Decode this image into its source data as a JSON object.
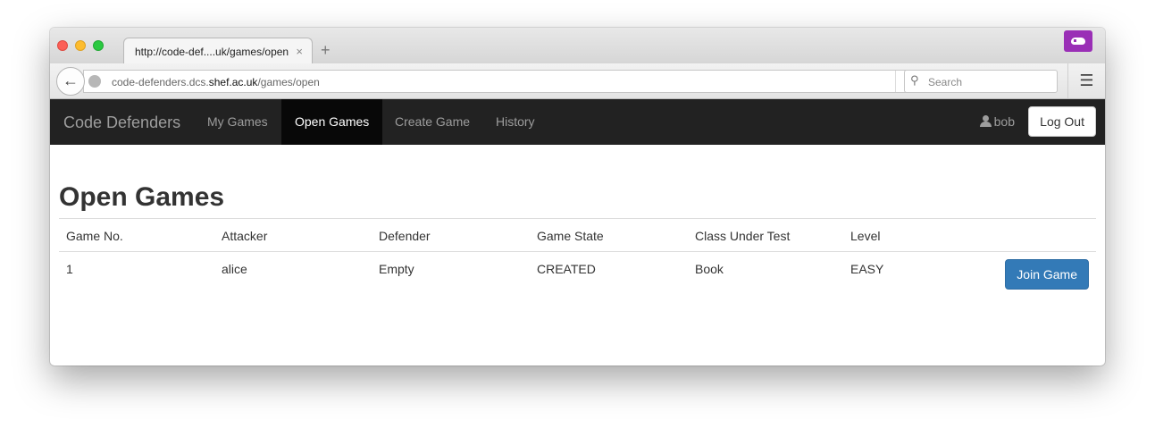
{
  "browser": {
    "tab_title": "http://code-def....uk/games/open",
    "tab_close": "×",
    "new_tab": "+",
    "url_prefix": "code-defenders.dcs.",
    "url_host": "shef.ac.uk",
    "url_path": "/games/open",
    "search_placeholder": "Search",
    "reload": "↻",
    "menu": "☰",
    "back": "←"
  },
  "navbar": {
    "brand": "Code Defenders",
    "items": [
      {
        "label": "My Games",
        "active": false
      },
      {
        "label": "Open Games",
        "active": true
      },
      {
        "label": "Create Game",
        "active": false
      },
      {
        "label": "History",
        "active": false
      }
    ],
    "user": "bob",
    "logout": "Log Out"
  },
  "main": {
    "title": "Open Games",
    "table": {
      "headers": [
        "Game No.",
        "Attacker",
        "Defender",
        "Game State",
        "Class Under Test",
        "Level",
        ""
      ],
      "rows": [
        {
          "game_no": "1",
          "attacker": "alice",
          "defender": "Empty",
          "state": "CREATED",
          "class": "Book",
          "level": "EASY",
          "action": "Join Game"
        }
      ]
    }
  },
  "colors": {
    "navbar_bg": "#222222",
    "navbar_active": "#080808",
    "primary": "#337ab7",
    "extension": "#9a2fb6"
  },
  "icons": [
    "back-arrow-icon",
    "globe-icon",
    "reload-icon",
    "search-icon",
    "hamburger-menu-icon",
    "user-icon",
    "extension-mask-icon"
  ]
}
